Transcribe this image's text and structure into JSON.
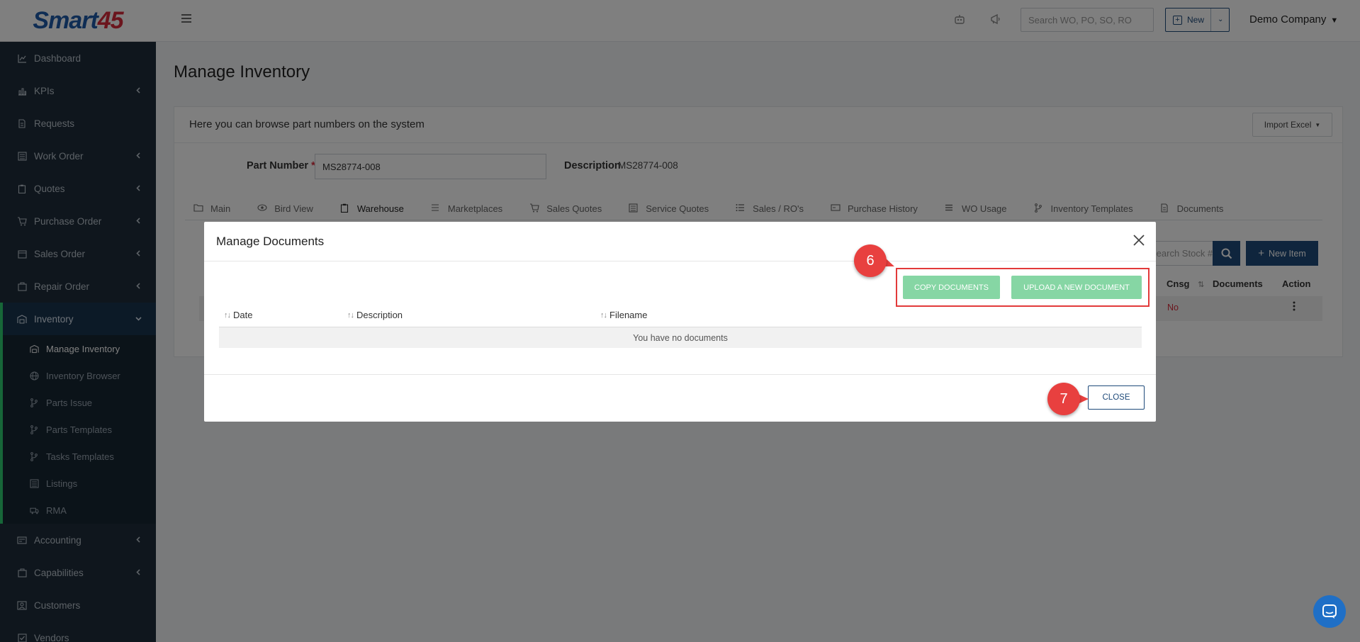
{
  "app": {
    "logo_text": "Smart",
    "logo_num": "45"
  },
  "sidebar": {
    "items": [
      {
        "label": "Dashboard",
        "icon": "chart-line-icon",
        "has_children": false
      },
      {
        "label": "KPIs",
        "icon": "bar-chart-icon",
        "has_children": true
      },
      {
        "label": "Requests",
        "icon": "document-icon",
        "has_children": false
      },
      {
        "label": "Work Order",
        "icon": "list-box-icon",
        "has_children": true
      },
      {
        "label": "Quotes",
        "icon": "clipboard-icon",
        "has_children": true
      },
      {
        "label": "Purchase Order",
        "icon": "cart-icon",
        "has_children": true
      },
      {
        "label": "Sales Order",
        "icon": "wallet-icon",
        "has_children": true
      },
      {
        "label": "Repair Order",
        "icon": "tools-icon",
        "has_children": true
      },
      {
        "label": "Inventory",
        "icon": "warehouse-icon",
        "has_children": true,
        "expanded": true
      }
    ],
    "inventory_sub": [
      {
        "label": "Manage Inventory",
        "icon": "warehouse-icon",
        "current": true
      },
      {
        "label": "Inventory Browser",
        "icon": "globe-icon"
      },
      {
        "label": "Parts Issue",
        "icon": "branch-icon"
      },
      {
        "label": "Parts Templates",
        "icon": "branch-icon"
      },
      {
        "label": "Tasks Templates",
        "icon": "branch-icon"
      },
      {
        "label": "Listings",
        "icon": "list-box-icon"
      },
      {
        "label": "RMA",
        "icon": "truck-icon"
      }
    ],
    "items_after": [
      {
        "label": "Accounting",
        "icon": "calculator-icon",
        "has_children": true
      },
      {
        "label": "Capabilities",
        "icon": "tools-icon",
        "has_children": true
      },
      {
        "label": "Customers",
        "icon": "users-icon",
        "has_children": false
      },
      {
        "label": "Vendors",
        "icon": "check-box-icon",
        "has_children": false
      }
    ]
  },
  "topbar": {
    "search_placeholder": "Search WO, PO, SO, RO",
    "new_label": "New",
    "company": "Demo Company"
  },
  "main": {
    "page_title": "Manage Inventory",
    "hint": "Here you can browse part numbers on the system",
    "import_label": "Import Excel",
    "part_number_label": "Part Number",
    "required_mark": "*",
    "part_number_value": "MS28774-008",
    "description_label": "Description",
    "description_value": "MS28774-008",
    "tabs": [
      {
        "label": "Main",
        "icon": "folder-icon"
      },
      {
        "label": "Bird View",
        "icon": "eye-icon"
      },
      {
        "label": "Warehouse",
        "icon": "clipboard-icon",
        "active": true
      },
      {
        "label": "Marketplaces",
        "icon": "lines-icon"
      },
      {
        "label": "Sales Quotes",
        "icon": "cart-icon"
      },
      {
        "label": "Service Quotes",
        "icon": "list-box-icon"
      },
      {
        "label": "Sales / RO's",
        "icon": "list-icon"
      },
      {
        "label": "Purchase History",
        "icon": "card-icon"
      },
      {
        "label": "WO Usage",
        "icon": "menu-icon"
      },
      {
        "label": "Inventory Templates",
        "icon": "branch-icon"
      },
      {
        "label": "Documents",
        "icon": "document-icon"
      }
    ],
    "stock_placeholder": "Search Stock #",
    "new_item_label": "New Item",
    "columns": {
      "cnsg": "Cnsg",
      "documents": "Documents",
      "action": "Action"
    },
    "row": {
      "cnsg": "No"
    }
  },
  "modal": {
    "title": "Manage Documents",
    "copy_label": "COPY DOCUMENTS",
    "upload_label": "UPLOAD A NEW DOCUMENT",
    "columns": [
      "Date",
      "Description",
      "Filename"
    ],
    "empty_text": "You have no documents",
    "close_label": "CLOSE"
  },
  "annotations": {
    "step_upload": "6",
    "step_close": "7"
  },
  "colors": {
    "sidebar_bg": "#1f2d3a",
    "primary": "#1e4a7a",
    "accent_green": "#2ecc71",
    "button_green": "#86d6a4",
    "annotation_red": "#e8403f"
  }
}
